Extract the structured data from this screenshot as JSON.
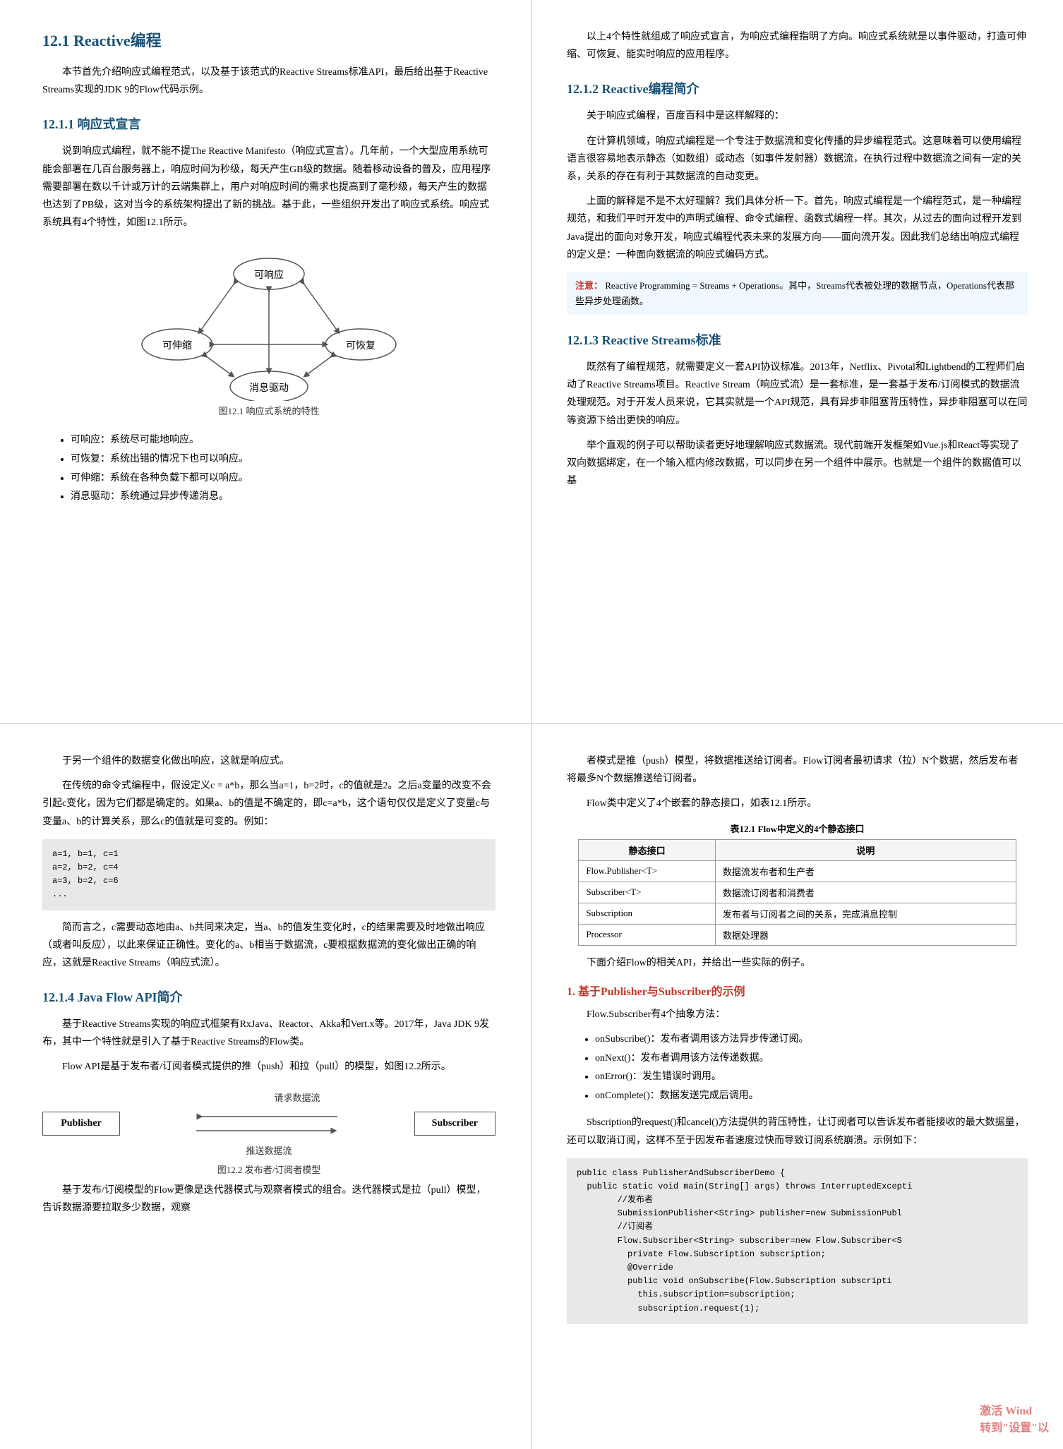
{
  "top": {
    "left": {
      "section_title": "12.1   Reactive编程",
      "intro_p1": "本节首先介绍响应式编程范式，以及基于该范式的Reactive Streams标准API，最后给出基于Reactive Streams实现的JDK 9的Flow代码示例。",
      "sub1_title": "12.1.1   响应式宣言",
      "sub1_p1": "说到响应式编程，就不能不提The Reactive Manifesto（响应式宣言）。几年前，一个大型应用系统可能会部署在几百台服务器上，响应时间为秒级，每天产生GB级的数据。随着移动设备的普及，应用程序需要部署在数以千计或万计的云端集群上，用户对响应时间的需求也提高到了毫秒级，每天产生的数据也达到了PB级，这对当今的系统架构提出了新的挑战。基于此，一些组织开发出了响应式系统。响应式系统具有4个特性，如图12.1所示。",
      "diagram_caption": "图12.1  响应式系统的特性",
      "diagram_nodes": [
        "可响应",
        "可伸缩",
        "可恢复",
        "消息驱动"
      ],
      "bullets": [
        "可响应：系统尽可能地响应。",
        "可恢复：系统出错的情况下也可以响应。",
        "可伸缩：系统在各种负载下都可以响应。",
        "消息驱动：系统通过异步传递消息。"
      ]
    },
    "right": {
      "intro_p1": "以上4个特性就组成了响应式宣言，为响应式编程指明了方向。响应式系统就是以事件驱动，打造可伸缩、可恢复、能实时响应的应用程序。",
      "sub2_title": "12.1.2   Reactive编程简介",
      "sub2_intro": "关于响应式编程，百度百科中是这样解释的：",
      "sub2_p1": "在计算机领域，响应式编程是一个专注于数据流和变化传播的异步编程范式。这意味着可以使用编程语言很容易地表示静态（如数组）或动态（如事件发射器）数据流，在执行过程中数据流之间有一定的关系，关系的存在有利于其数据流的自动变更。",
      "sub2_p2": "上面的解释是不是不太好理解？我们具体分析一下。首先，响应式编程是一个编程范式，是一种编程规范，和我们平时开发中的声明式编程、命令式编程、函数式编程一样。其次，从过去的面向过程开发到Java提出的面向对象开发，响应式编程代表未来的发展方向——面向流开发。因此我们总结出响应式编程的定义是：一种面向数据流的响应式编码方式。",
      "note_label": "注意：",
      "note_text": "Reactive Programming = Streams + Operations。其中，Streams代表被处理的数据节点，Operations代表那些异步处理函数。",
      "sub3_title": "12.1.3   Reactive Streams标准",
      "sub3_p1": "既然有了编程规范，就需要定义一套API协议标准。2013年，Netflix、Pivotal和Lightbend的工程师们启动了Reactive Streams项目。Reactive Stream（响应式流）是一套标准，是一套基于发布/订阅模式的数据流处理规范。对于开发人员来说，它其实就是一个API规范，具有异步非阻塞背压特性，异步非阻塞可以在同等资源下给出更快的响应。",
      "sub3_p2": "举个直观的例子可以帮助读者更好地理解响应式数据流。现代前端开发框架如Vue.js和React等实现了双向数据绑定，在一个输入框内修改数据，可以同步在另一个组件中展示。也就是一个组件的数据值可以基"
    }
  },
  "bottom": {
    "left": {
      "cont_p1": "于另一个组件的数据变化做出响应，这就是响应式。",
      "cont_p2": "在传统的命令式编程中，假设定义c = a*b，那么当a=1，b=2时，c的值就是2。之后a变量的改变不会引起c变化，因为它们都是确定的。如果a、b的值是不确定的，即c=a*b，这个语句仅仅是定义了变量c与变量a、b的计算关系，那么c的值就是可变的。例如：",
      "code_block": "a=1, b=1, c=1\na=2, b=2, c=4\na=3, b=2, c=6\n...",
      "cont_p3": "简而言之，c需要动态地由a、b共同来决定，当a、b的值发生变化时，c的结果需要及时地做出响应（或者叫反应），以此来保证正确性。变化的a、b相当于数据流，c要根据数据流的变化做出正确的响应，这就是Reactive Streams（响应式流）。",
      "sub4_title": "12.1.4   Java Flow API简介",
      "sub4_p1": "基于Reactive Streams实现的响应式框架有RxJava、Reactor、Akka和Vert.x等。2017年，Java JDK 9发布，其中一个特性就是引入了基于Reactive Streams的Flow类。",
      "sub4_p2": "Flow API是基于发布者/订阅者模式提供的推（push）和拉（pull）的模型，如图12.2所示。",
      "pub_sub_label_req": "请求数据流",
      "pub_sub_label_push": "推送数据流",
      "pub_sub_caption": "图12.2  发布者/订阅者模型",
      "pub_label": "Publisher",
      "sub_label": "Subscriber",
      "cont_p4": "基于发布/订阅模型的Flow更像是迭代器模式与观察者模式的组合。迭代器模式是拉（pull）模型，告诉数据源要拉取多少数据，观察"
    },
    "right": {
      "cont_p1": "者模式是推（push）模型，将数据推送给订阅者。Flow订阅者最初请求（拉）N个数据，然后发布者将最多N个数据推送给订阅者。",
      "cont_p2": "Flow类中定义了4个嵌套的静态接口，如表12.1所示。",
      "table_caption": "表12.1  Flow中定义的4个静态接口",
      "table_headers": [
        "静态接口",
        "说明"
      ],
      "table_rows": [
        [
          "Flow.Publisher<T>",
          "数据流发布者和生产者"
        ],
        [
          "Subscriber<T>",
          "数据流订阅者和消费者"
        ],
        [
          "Subscription",
          "发布者与订阅者之间的关系，完成消息控制"
        ],
        [
          "Processor",
          "数据处理器"
        ]
      ],
      "cont_p3": "下面介绍Flow的相关API，并给出一些实际的例子。",
      "example_title": "1. 基于Publisher与Subscriber的示例",
      "example_p1": "Flow.Subscriber有4个抽象方法：",
      "bullets": [
        "onSubscribe()：发布者调用该方法异步传递订阅。",
        "onNext()：发布者调用该方法传递数据。",
        "onError()：发生错误时调用。",
        "onComplete()：数据发送完成后调用。"
      ],
      "sbscription_p": "Sbscription的request()和cancel()方法提供的背压特性，让订阅者可以告诉发布者能接收的最大数据量，还可以取消订阅，这样不至于因发布者速度过快而导致订阅系统崩溃。示例如下：",
      "code_block": "public class PublisherAndSubscriberDemo {\n  public static void main(String[] args) throws InterruptedExcepti\n        //发布者\n        SubmissionPublisher<String> publisher=new SubmissionPubl\n        //订阅者\n        Flow.Subscriber<String> subscriber=new Flow.Subscriber<S\n          private Flow.Subscription subscription;\n          @Override\n          public void onSubscribe(Flow.Subscription subscripti\n            this.subscription=subscription;\n            subscription.request(1);"
    }
  },
  "watermark": {
    "line1": "激活 Wind",
    "line2": "转到\"设置\"以"
  }
}
